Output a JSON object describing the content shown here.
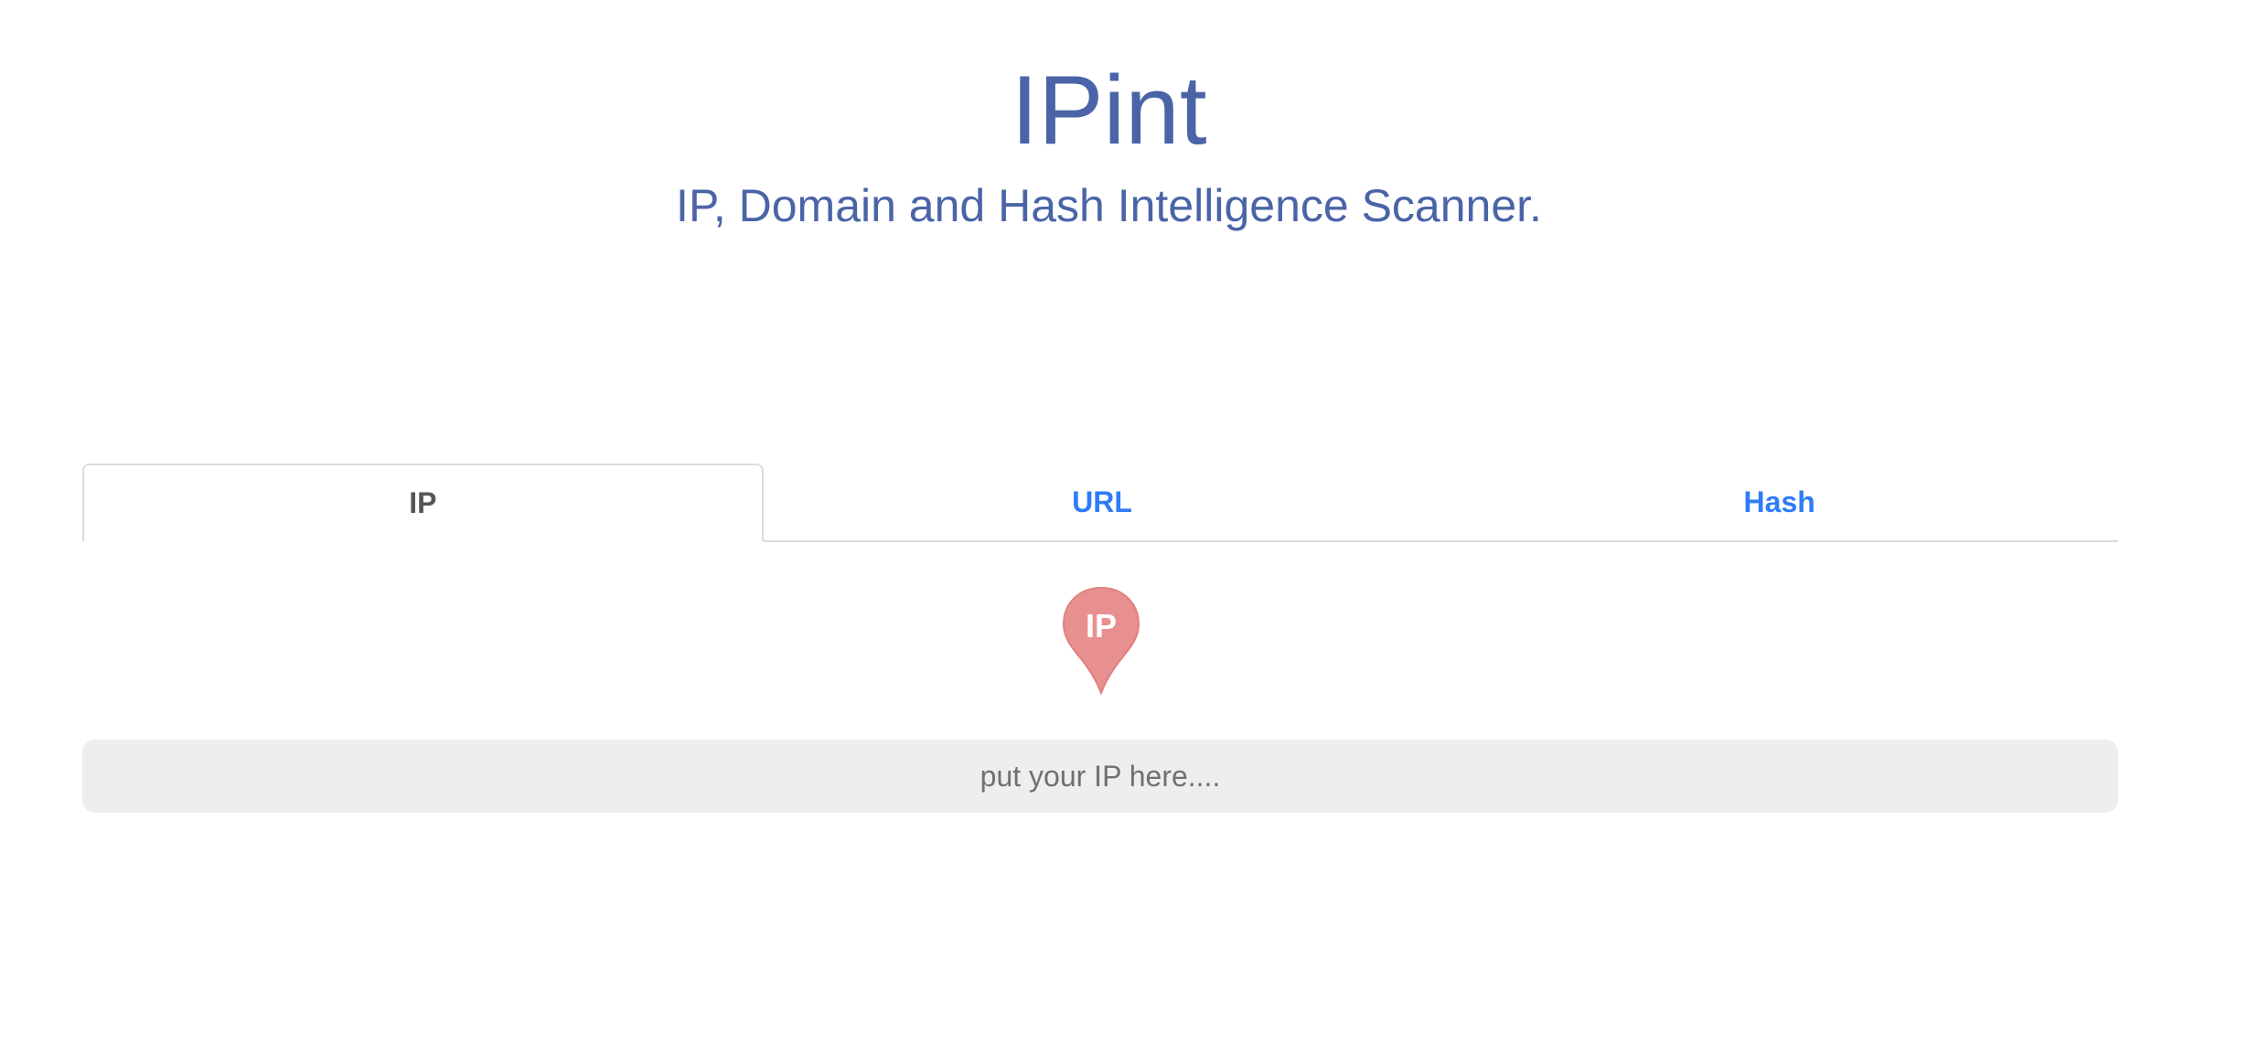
{
  "header": {
    "title": "IPint",
    "subtitle": "IP, Domain and Hash Intelligence Scanner."
  },
  "tabs": [
    {
      "label": "IP",
      "active": true
    },
    {
      "label": "URL",
      "active": false
    },
    {
      "label": "Hash",
      "active": false
    }
  ],
  "pin_icon": {
    "icon": "map-pin-icon",
    "label": "IP",
    "color": "#e89090"
  },
  "search": {
    "value": "",
    "placeholder": "put your IP here...."
  },
  "colors": {
    "title": "#4a64a7",
    "tab_link": "#2f7cf6",
    "tab_active": "#555555",
    "input_background": "#eeeeee"
  }
}
